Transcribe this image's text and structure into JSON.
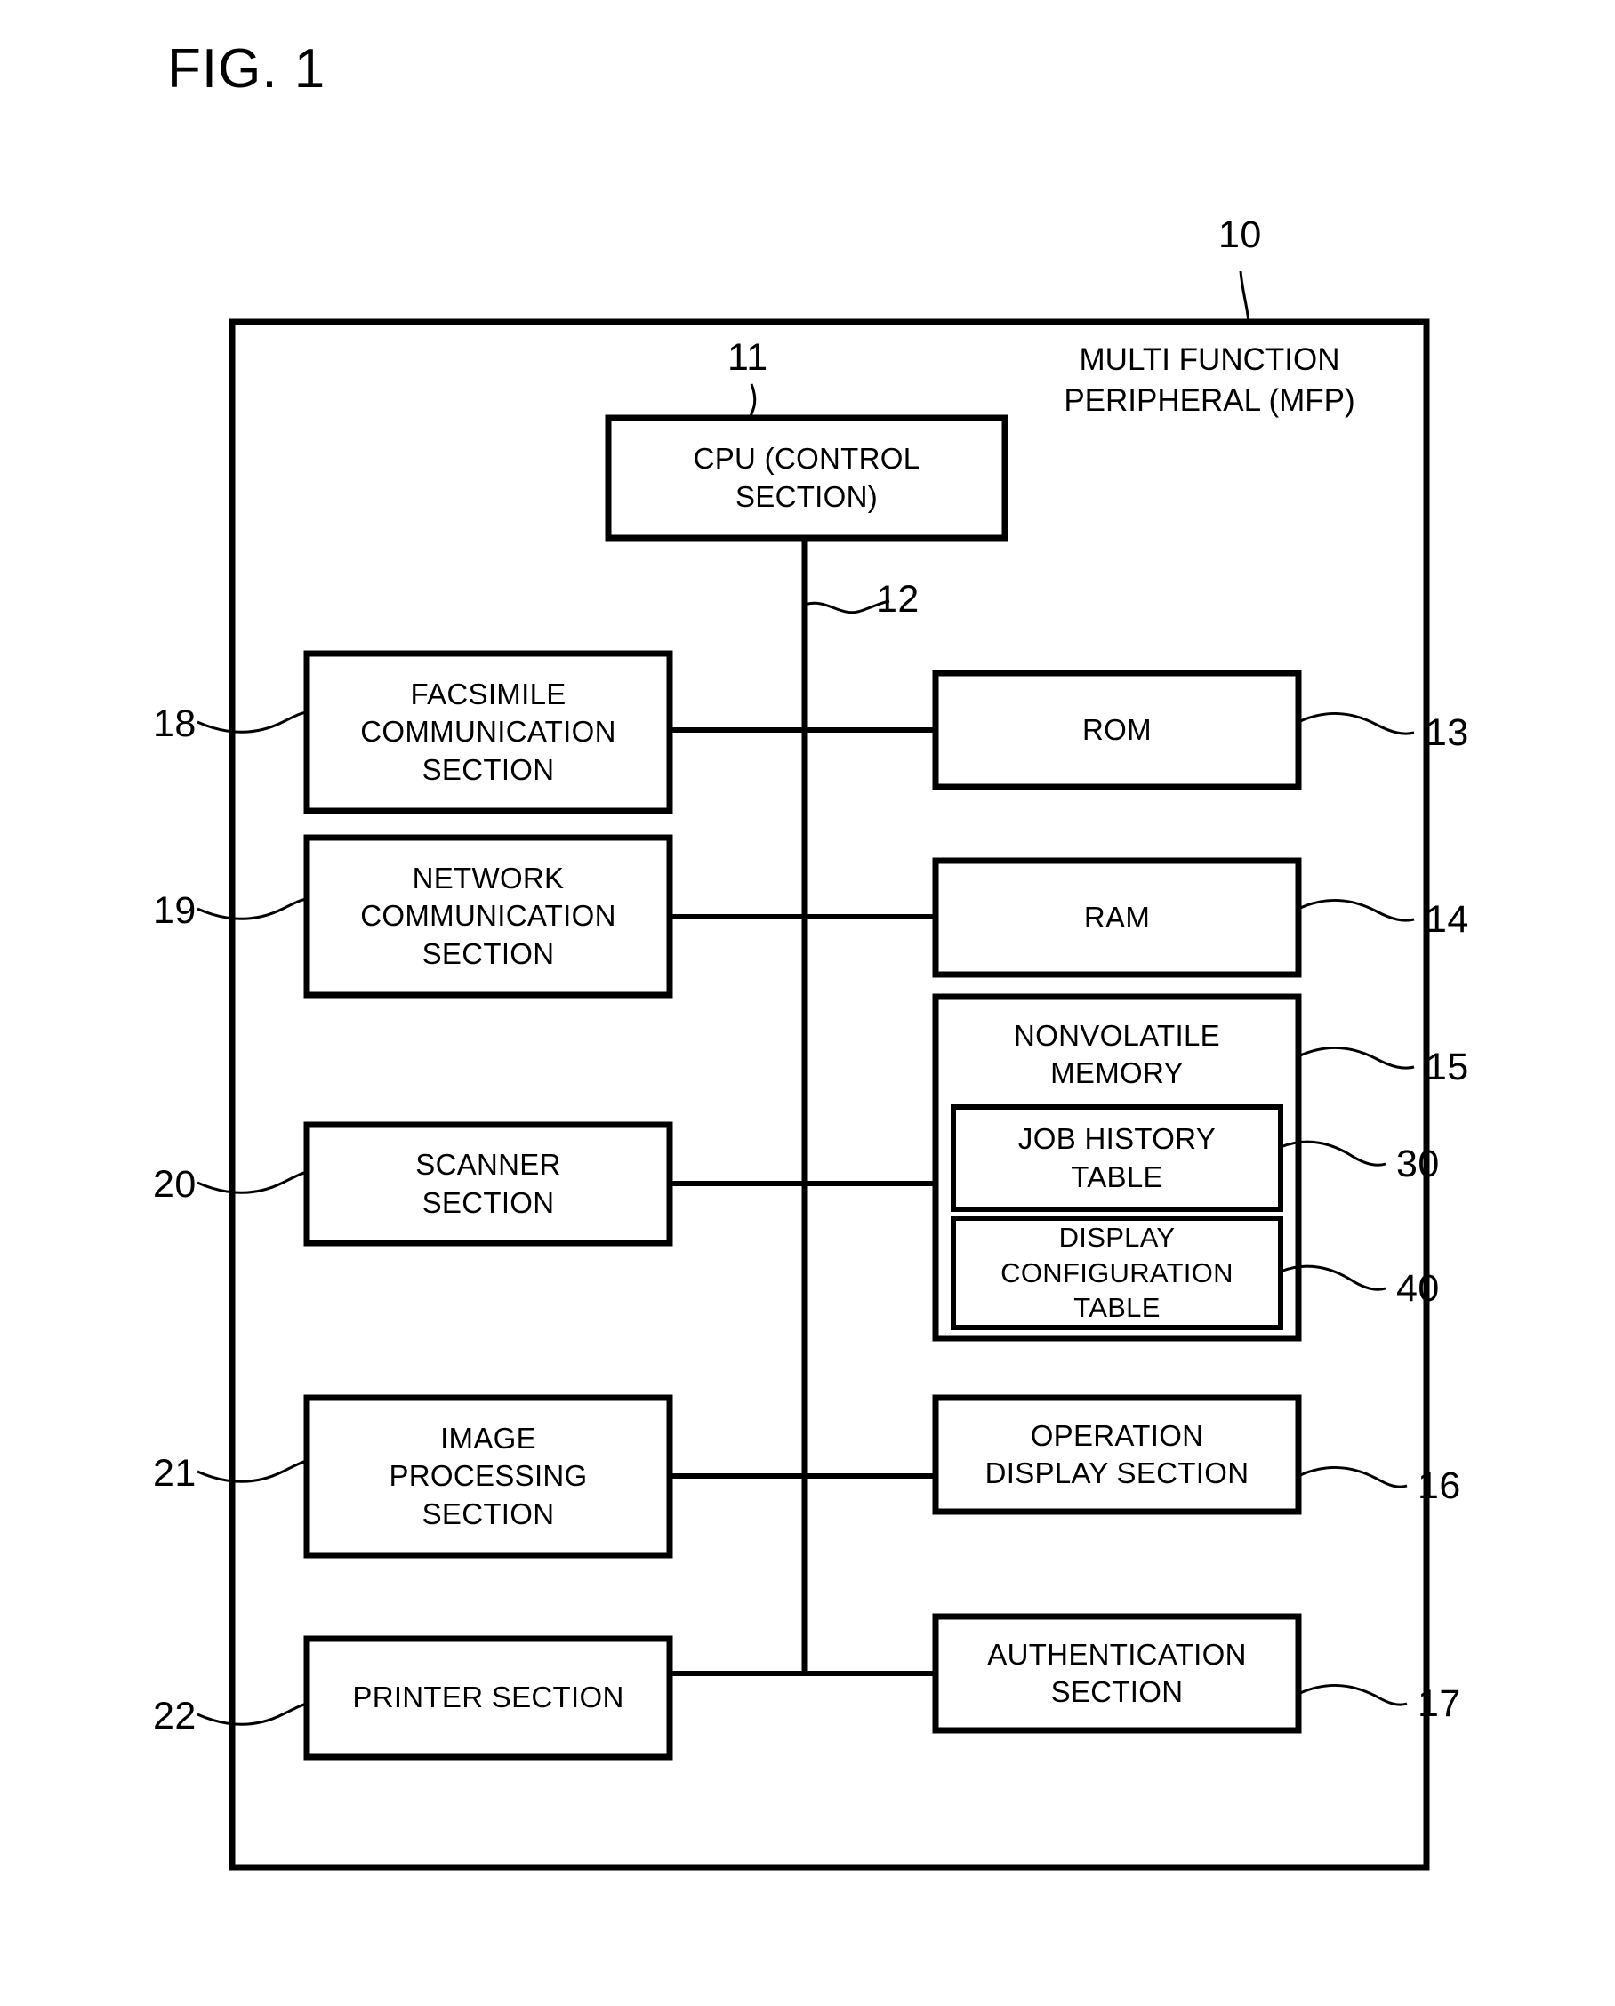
{
  "figure": {
    "title": "FIG. 1",
    "outer_label": "MULTI FUNCTION\nPERIPHERAL (MFP)",
    "outer_ref": "10",
    "bus_ref": "12"
  },
  "cpu": {
    "label": "CPU (CONTROL\nSECTION)",
    "ref": "11"
  },
  "left_column": [
    {
      "label": "FACSIMILE\nCOMMUNICATION\nSECTION",
      "ref": "18"
    },
    {
      "label": "NETWORK\nCOMMUNICATION\nSECTION",
      "ref": "19"
    },
    {
      "label": "SCANNER\nSECTION",
      "ref": "20"
    },
    {
      "label": "IMAGE\nPROCESSING\nSECTION",
      "ref": "21"
    },
    {
      "label": "PRINTER SECTION",
      "ref": "22"
    }
  ],
  "right_column": [
    {
      "label": "ROM",
      "ref": "13"
    },
    {
      "label": "RAM",
      "ref": "14"
    },
    {
      "label": "NONVOLATILE\nMEMORY",
      "ref": "15"
    },
    {
      "label": "OPERATION\nDISPLAY SECTION",
      "ref": "16"
    },
    {
      "label": "AUTHENTICATION\nSECTION",
      "ref": "17"
    }
  ],
  "memory_tables": [
    {
      "label": "JOB HISTORY\nTABLE",
      "ref": "30"
    },
    {
      "label": "DISPLAY\nCONFIGURATION\nTABLE",
      "ref": "40"
    }
  ],
  "colors": {
    "line": "#000000",
    "background": "#ffffff"
  }
}
